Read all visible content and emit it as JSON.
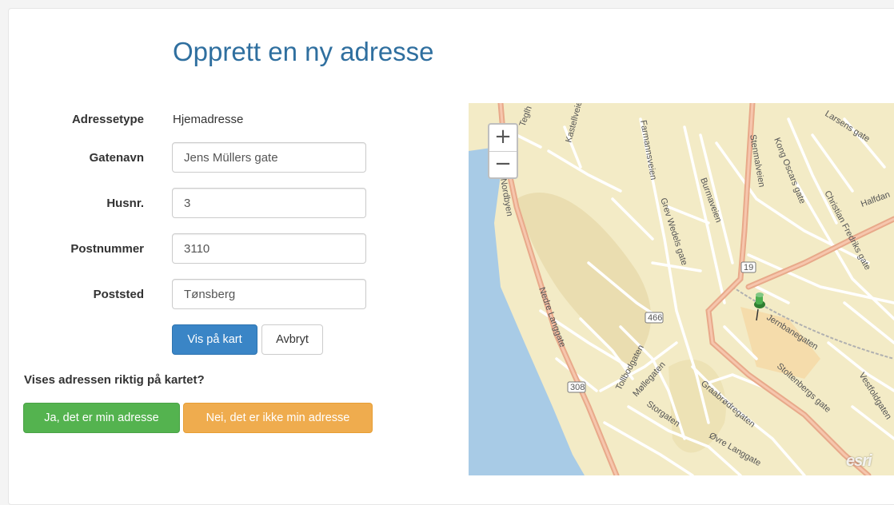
{
  "page": {
    "title": "Opprett en ny adresse"
  },
  "form": {
    "address_type": {
      "label": "Adressetype",
      "value": "Hjemadresse"
    },
    "street": {
      "label": "Gatenavn",
      "value": "Jens Müllers gate"
    },
    "house_no": {
      "label": "Husnr.",
      "value": "3"
    },
    "postal_code": {
      "label": "Postnummer",
      "value": "3110"
    },
    "city": {
      "label": "Poststed",
      "value": "Tønsberg"
    },
    "show_on_map_button": "Vis på kart",
    "cancel_button": "Avbryt"
  },
  "confirm": {
    "question": "Vises adressen riktig på kartet?",
    "yes_button": "Ja, det er min adresse",
    "no_button": "Nei, det er ikke min adresse"
  },
  "map": {
    "zoom_in": "+",
    "zoom_out": "−",
    "attribution": "esri",
    "road_shields": [
      "19",
      "466",
      "308"
    ],
    "street_labels": [
      "Farmannsveien",
      "Grev Wedels gate",
      "Burmaveien",
      "Stenmalveien",
      "Kong Oscars gate",
      "Christian Fredriks gate",
      "Halfdan",
      "Nedre Langgate",
      "Tollbodgaten",
      "Møllegaten",
      "Storgaten",
      "Graabrødregaten",
      "Øvre Langgate",
      "Jernbanegaten",
      "Stoltenbergs gate",
      "Vestfoldgaten",
      "Kastellveien",
      "Larsens gate",
      "Nordbyen",
      "Teglh"
    ],
    "marker_icon": "pushpin-icon"
  }
}
